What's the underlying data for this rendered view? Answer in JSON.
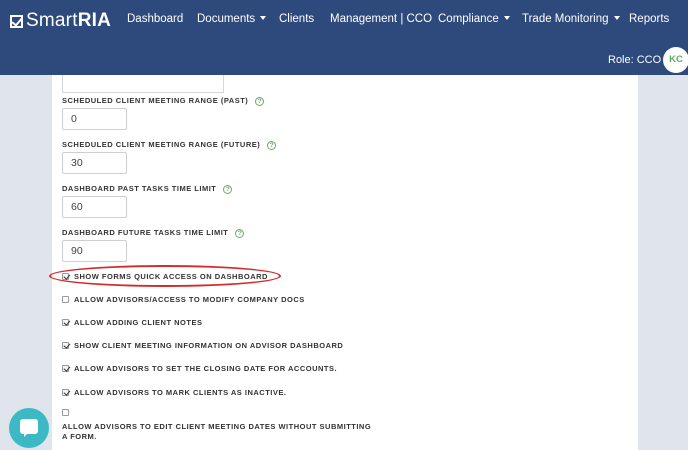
{
  "brand": {
    "light": "Smart",
    "bold": "RIA"
  },
  "nav": {
    "dashboard": "Dashboard",
    "documents": "Documents",
    "clients": "Clients",
    "management": "Management | CCO",
    "compliance": "Compliance",
    "trade_monitoring": "Trade Monitoring",
    "reports": "Reports"
  },
  "user": {
    "role": "Role: CCO",
    "initials": "KC"
  },
  "fields": [
    {
      "label": "SCHEDULED CLIENT MEETING RANGE (PAST)",
      "value": "0"
    },
    {
      "label": "SCHEDULED CLIENT MEETING RANGE (FUTURE)",
      "value": "30"
    },
    {
      "label": "DASHBOARD PAST TASKS TIME LIMIT",
      "value": "60"
    },
    {
      "label": "DASHBOARD FUTURE TASKS TIME LIMIT",
      "value": "90"
    }
  ],
  "help_glyph": "?",
  "checkboxes": [
    {
      "label": "SHOW FORMS QUICK ACCESS ON DASHBOARD",
      "checked": true
    },
    {
      "label": "ALLOW ADVISORS/ACCESS TO MODIFY COMPANY DOCS",
      "checked": false
    },
    {
      "label": "ALLOW ADDING CLIENT NOTES",
      "checked": true
    },
    {
      "label": "SHOW CLIENT MEETING INFORMATION ON ADVISOR DASHBOARD",
      "checked": true
    },
    {
      "label": "ALLOW ADVISORS TO SET THE CLOSING DATE FOR ACCOUNTS.",
      "checked": true
    },
    {
      "label": "ALLOW ADVISORS TO MARK CLIENTS AS INACTIVE.",
      "checked": true
    },
    {
      "label": "ALLOW ADVISORS TO EDIT CLIENT MEETING DATES WITHOUT SUBMITTING A FORM.",
      "checked": false
    }
  ],
  "colors": {
    "nav_bg": "#2e4a7d",
    "highlight": "#d42a2a",
    "help_icon": "#6aaa6a",
    "chat": "#3db8c5"
  }
}
